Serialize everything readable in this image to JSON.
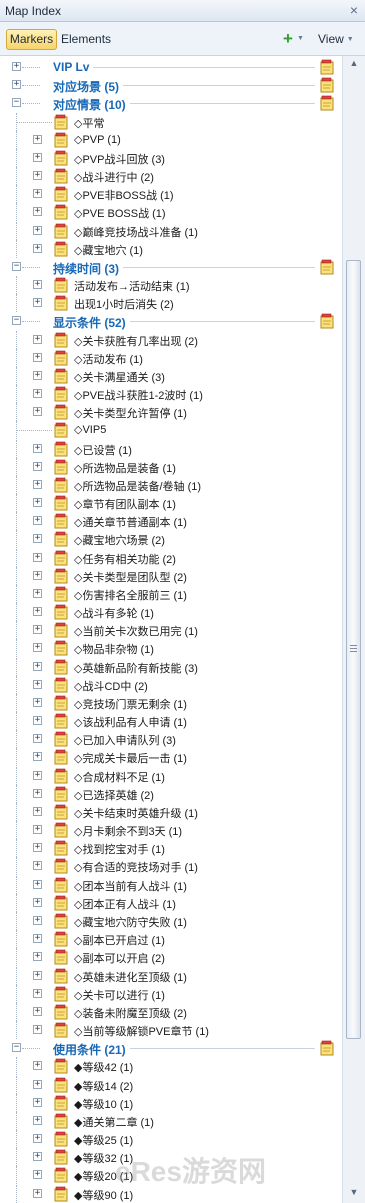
{
  "window": {
    "title": "Map Index",
    "close_label": "×"
  },
  "toolbar": {
    "tab_markers": "Markers",
    "tab_elements": "Elements",
    "add_label": "+",
    "view_label": "View"
  },
  "scrollbar": {
    "up": "▲",
    "down": "▼"
  },
  "tree": [
    {
      "kind": "cat",
      "label": "VIP Lv",
      "expanded": false
    },
    {
      "kind": "cat",
      "label": "对应场景 (5)",
      "expanded": false
    },
    {
      "kind": "cat",
      "label": "对应情景 (10)",
      "expanded": true
    },
    {
      "kind": "item",
      "label": "◇平常",
      "expander": false
    },
    {
      "kind": "item",
      "label": "◇PVP (1)",
      "expander": true
    },
    {
      "kind": "item",
      "label": "◇PVP战斗回放 (3)",
      "expander": true
    },
    {
      "kind": "item",
      "label": "◇战斗进行中 (2)",
      "expander": true
    },
    {
      "kind": "item",
      "label": "◇PVE非BOSS战 (1)",
      "expander": true
    },
    {
      "kind": "item",
      "label": "◇PVE BOSS战 (1)",
      "expander": true
    },
    {
      "kind": "item",
      "label": "◇巅峰竞技场战斗准备 (1)",
      "expander": true
    },
    {
      "kind": "item",
      "label": "◇藏宝地穴 (1)",
      "expander": true
    },
    {
      "kind": "cat",
      "label": "持续时间 (3)",
      "expanded": true
    },
    {
      "kind": "item",
      "label": "活动发布→活动结束 (1)",
      "expander": true
    },
    {
      "kind": "item",
      "label": "出现1小时后消失 (2)",
      "expander": true
    },
    {
      "kind": "cat",
      "label": "显示条件 (52)",
      "expanded": true
    },
    {
      "kind": "item",
      "label": "◇关卡获胜有几率出现 (2)",
      "expander": true
    },
    {
      "kind": "item",
      "label": "◇活动发布 (1)",
      "expander": true
    },
    {
      "kind": "item",
      "label": "◇关卡满星通关 (3)",
      "expander": true
    },
    {
      "kind": "item",
      "label": "◇PVE战斗获胜1-2波时 (1)",
      "expander": true
    },
    {
      "kind": "item",
      "label": "◇关卡类型允许暂停 (1)",
      "expander": true
    },
    {
      "kind": "item",
      "label": "◇VIP5",
      "expander": false
    },
    {
      "kind": "item",
      "label": "◇已设营 (1)",
      "expander": true
    },
    {
      "kind": "item",
      "label": "◇所选物品是装备 (1)",
      "expander": true
    },
    {
      "kind": "item",
      "label": "◇所选物品是装备/卷轴 (1)",
      "expander": true
    },
    {
      "kind": "item",
      "label": "◇章节有团队副本 (1)",
      "expander": true
    },
    {
      "kind": "item",
      "label": "◇通关章节普通副本 (1)",
      "expander": true
    },
    {
      "kind": "item",
      "label": "◇藏宝地穴场景 (2)",
      "expander": true
    },
    {
      "kind": "item",
      "label": "◇任务有相关功能 (2)",
      "expander": true
    },
    {
      "kind": "item",
      "label": "◇关卡类型是团队型 (2)",
      "expander": true
    },
    {
      "kind": "item",
      "label": "◇伤害排名全服前三 (1)",
      "expander": true
    },
    {
      "kind": "item",
      "label": "◇战斗有多轮 (1)",
      "expander": true
    },
    {
      "kind": "item",
      "label": "◇当前关卡次数已用完 (1)",
      "expander": true
    },
    {
      "kind": "item",
      "label": "◇物品非杂物 (1)",
      "expander": true
    },
    {
      "kind": "item",
      "label": "◇英雄新品阶有新技能 (3)",
      "expander": true
    },
    {
      "kind": "item",
      "label": "◇战斗CD中 (2)",
      "expander": true
    },
    {
      "kind": "item",
      "label": "◇竞技场门票无剩余 (1)",
      "expander": true
    },
    {
      "kind": "item",
      "label": "◇该战利品有人申请 (1)",
      "expander": true
    },
    {
      "kind": "item",
      "label": "◇已加入申请队列 (3)",
      "expander": true
    },
    {
      "kind": "item",
      "label": "◇完成关卡最后一击 (1)",
      "expander": true
    },
    {
      "kind": "item",
      "label": "◇合成材料不足 (1)",
      "expander": true
    },
    {
      "kind": "item",
      "label": "◇已选择英雄 (2)",
      "expander": true
    },
    {
      "kind": "item",
      "label": "◇关卡结束时英雄升级 (1)",
      "expander": true
    },
    {
      "kind": "item",
      "label": "◇月卡剩余不到3天 (1)",
      "expander": true
    },
    {
      "kind": "item",
      "label": "◇找到挖宝对手 (1)",
      "expander": true
    },
    {
      "kind": "item",
      "label": "◇有合适的竞技场对手 (1)",
      "expander": true
    },
    {
      "kind": "item",
      "label": "◇团本当前有人战斗 (1)",
      "expander": true
    },
    {
      "kind": "item",
      "label": "◇团本正有人战斗 (1)",
      "expander": true
    },
    {
      "kind": "item",
      "label": "◇藏宝地穴防守失败 (1)",
      "expander": true
    },
    {
      "kind": "item",
      "label": "◇副本已开启过 (1)",
      "expander": true
    },
    {
      "kind": "item",
      "label": "◇副本可以开启 (2)",
      "expander": true
    },
    {
      "kind": "item",
      "label": "◇英雄未进化至顶级 (1)",
      "expander": true
    },
    {
      "kind": "item",
      "label": "◇关卡可以进行 (1)",
      "expander": true
    },
    {
      "kind": "item",
      "label": "◇装备未附魔至顶级 (2)",
      "expander": true
    },
    {
      "kind": "item",
      "label": "◇当前等级解锁PVE章节 (1)",
      "expander": true
    },
    {
      "kind": "cat",
      "label": "使用条件 (21)",
      "expanded": true
    },
    {
      "kind": "item",
      "label": "◆等级42 (1)",
      "expander": true
    },
    {
      "kind": "item",
      "label": "◆等级14 (2)",
      "expander": true
    },
    {
      "kind": "item",
      "label": "◆等级10 (1)",
      "expander": true
    },
    {
      "kind": "item",
      "label": "◆通关第二章 (1)",
      "expander": true
    },
    {
      "kind": "item",
      "label": "◆等级25 (1)",
      "expander": true
    },
    {
      "kind": "item",
      "label": "◆等级32 (1)",
      "expander": true
    },
    {
      "kind": "item",
      "label": "◆等级20 (1)",
      "expander": true
    },
    {
      "kind": "item",
      "label": "◆等级90 (1)",
      "expander": true
    }
  ],
  "watermark": "eRes游资网"
}
